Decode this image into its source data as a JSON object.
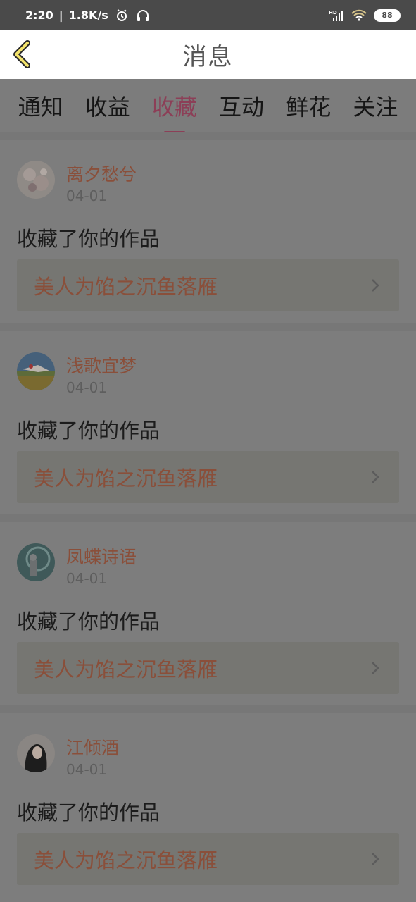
{
  "status_bar": {
    "time": "2:20",
    "speed": "1.8K/s",
    "battery": "88",
    "icons": [
      "alarm-icon",
      "headphones-icon",
      "hd-signal-icon",
      "wifi-icon",
      "battery-icon"
    ]
  },
  "navbar": {
    "title": "消息",
    "back_icon": "chevron-left-icon"
  },
  "tabs": [
    {
      "label": "通知"
    },
    {
      "label": "收益"
    },
    {
      "label": "收藏",
      "active": true
    },
    {
      "label": "互动"
    },
    {
      "label": "鲜花"
    },
    {
      "label": "关注"
    }
  ],
  "notifications": [
    {
      "username": "离夕愁兮",
      "date": "04-01",
      "action": "收藏了你的作品",
      "work_title": "美人为馅之沉鱼落雁"
    },
    {
      "username": "浅歌宜梦",
      "date": "04-01",
      "action": "收藏了你的作品",
      "work_title": "美人为馅之沉鱼落雁"
    },
    {
      "username": "凤蝶诗语",
      "date": "04-01",
      "action": "收藏了你的作品",
      "work_title": "美人为馅之沉鱼落雁"
    },
    {
      "username": "江倾酒",
      "date": "04-01",
      "action": "收藏了你的作品",
      "work_title": "美人为馅之沉鱼落雁"
    }
  ],
  "colors": {
    "accent": "#8c3f57",
    "username": "#8a4f3a",
    "overlay": "#7d7d7d"
  }
}
